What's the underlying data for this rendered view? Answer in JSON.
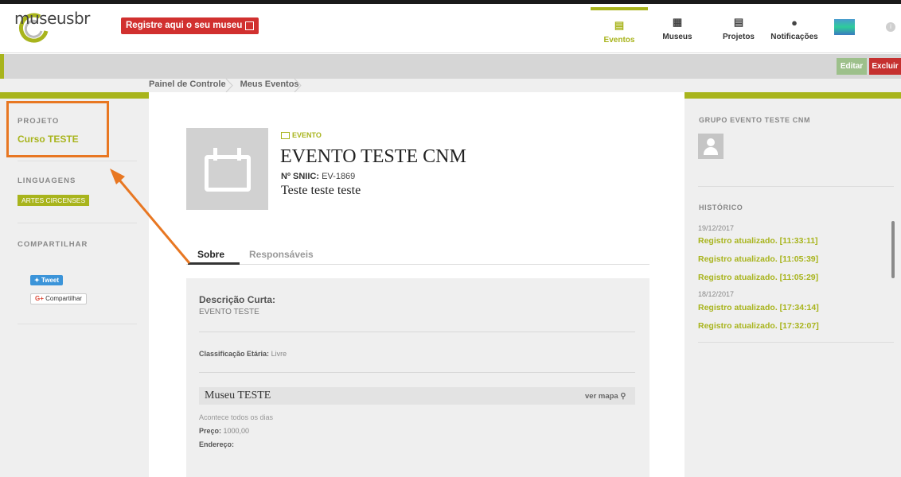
{
  "header": {
    "logo_text": "museusbr",
    "register_label": "Registre aqui o seu museu",
    "nav": [
      {
        "label": "Eventos",
        "icon": "calendar-icon"
      },
      {
        "label": "Museus",
        "icon": "building-icon"
      },
      {
        "label": "Projetos",
        "icon": "document-icon"
      },
      {
        "label": "Notificações",
        "icon": "chat-bubble-icon"
      }
    ]
  },
  "actions": {
    "edit_label": "Editar",
    "delete_label": "Excluir"
  },
  "breadcrumb": [
    "Painel de Controle",
    "Meus Eventos"
  ],
  "left_sidebar": {
    "projeto_title": "PROJETO",
    "projeto_value": "Curso TESTE",
    "linguagens_title": "LINGUAGENS",
    "linguagens_tag": "ARTES CIRCENSES",
    "compartilhar_title": "COMPARTILHAR",
    "tweet_label": "Tweet",
    "share_label": "Compartilhar",
    "share_prefix": "G+"
  },
  "event": {
    "type_label": "EVENTO",
    "title": "EVENTO TESTE CNM",
    "sniic_label": "Nº SNIIC:",
    "sniic_value": "EV-1869",
    "subtitle": "Teste teste teste"
  },
  "tabs": [
    {
      "label": "Sobre"
    },
    {
      "label": "Responsáveis"
    }
  ],
  "about": {
    "desc_label": "Descrição Curta:",
    "desc_value": "EVENTO TESTE",
    "class_label": "Classificação Etária:",
    "class_value": "Livre",
    "museum_name": "Museu TESTE",
    "map_label": "ver mapa",
    "frequency": "Acontece todos os dias",
    "price_label": "Preço:",
    "price_value": "1000,00",
    "address_label": "Endereço:"
  },
  "right_sidebar": {
    "grupo_title": "GRUPO EVENTO TESTE CNM",
    "hist_title": "HISTÓRICO",
    "history": [
      {
        "date": "19/12/2017",
        "entries": [
          "Registro atualizado. [11:33:11]",
          "Registro atualizado. [11:05:39]",
          "Registro atualizado. [11:05:29]"
        ]
      },
      {
        "date": "18/12/2017",
        "entries": [
          "Registro atualizado. [17:34:14]",
          "Registro atualizado. [17:32:07]"
        ]
      }
    ]
  },
  "colors": {
    "accent": "#a8b41c",
    "danger": "#c5302f",
    "annotation": "#e87722"
  }
}
